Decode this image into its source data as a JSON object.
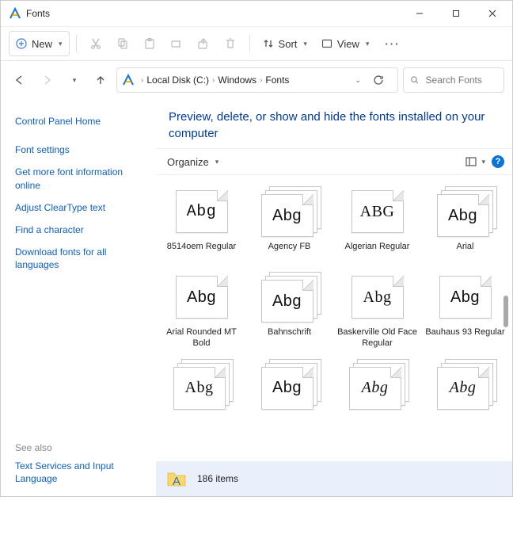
{
  "window": {
    "title": "Fonts"
  },
  "cmdbar": {
    "new_label": "New",
    "sort_label": "Sort",
    "view_label": "View"
  },
  "breadcrumb": {
    "segments": [
      "Local Disk (C:)",
      "Windows",
      "Fonts"
    ]
  },
  "search": {
    "placeholder": "Search Fonts"
  },
  "leftnav": {
    "home": "Control Panel Home",
    "links": [
      "Font settings",
      "Get more font information online",
      "Adjust ClearType text",
      "Find a character",
      "Download fonts for all languages"
    ],
    "seealso_label": "See also",
    "seealso_links": [
      "Text Services and Input Language"
    ]
  },
  "main": {
    "heading": "Preview, delete, or show and hide the fonts installed on your computer",
    "organize_label": "Organize"
  },
  "fonts": [
    {
      "label": "8514oem Regular",
      "sample": "Abg",
      "stack": false,
      "cls": "f0"
    },
    {
      "label": "Agency FB",
      "sample": "Abg",
      "stack": true,
      "cls": "f1"
    },
    {
      "label": "Algerian Regular",
      "sample": "ABG",
      "stack": false,
      "cls": "f2"
    },
    {
      "label": "Arial",
      "sample": "Abg",
      "stack": true,
      "cls": "f3"
    },
    {
      "label": "Arial Rounded MT Bold",
      "sample": "Abg",
      "stack": false,
      "cls": "f4"
    },
    {
      "label": "Bahnschrift",
      "sample": "Abg",
      "stack": true,
      "cls": "f5"
    },
    {
      "label": "Baskerville Old Face Regular",
      "sample": "Abg",
      "stack": false,
      "cls": "f6"
    },
    {
      "label": "Bauhaus 93 Regular",
      "sample": "Abg",
      "stack": false,
      "cls": "f7"
    },
    {
      "label": "",
      "sample": "Abg",
      "stack": true,
      "cls": "f8"
    },
    {
      "label": "",
      "sample": "Abg",
      "stack": true,
      "cls": "f9"
    },
    {
      "label": "",
      "sample": "Abg",
      "stack": true,
      "cls": "f10"
    },
    {
      "label": "",
      "sample": "Abg",
      "stack": true,
      "cls": "f11"
    }
  ],
  "status": {
    "count_text": "186 items"
  }
}
